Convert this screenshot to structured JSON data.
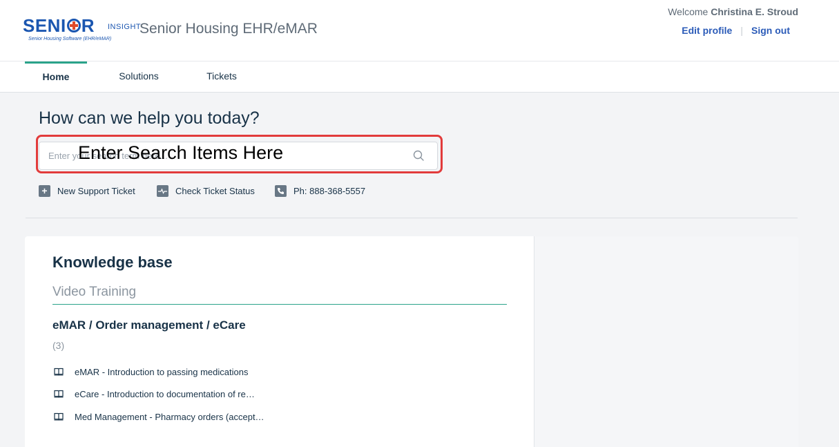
{
  "header": {
    "logo": {
      "main": "SENIOR",
      "suffix": "INSIGHT",
      "tagline": "Senior Housing Software (EHR/eMAR)"
    },
    "app_title": "Senior Housing EHR/eMAR",
    "welcome_prefix": "Welcome",
    "user_name": "Christina E. Stroud",
    "edit_profile": "Edit profile",
    "sign_out": "Sign out"
  },
  "nav": {
    "tabs": [
      {
        "label": "Home",
        "active": true
      },
      {
        "label": "Solutions",
        "active": false
      },
      {
        "label": "Tickets",
        "active": false
      }
    ]
  },
  "hero": {
    "title": "How can we help you today?",
    "search_placeholder": "Enter your search term here...",
    "annotation": "Enter Search Items Here",
    "quick_links": [
      {
        "label": "New Support Ticket",
        "icon": "plus-icon"
      },
      {
        "label": "Check Ticket Status",
        "icon": "pulse-icon"
      },
      {
        "label": "Ph: 888-368-5557",
        "icon": "phone-icon"
      }
    ]
  },
  "knowledge_base": {
    "title": "Knowledge base",
    "section": "Video Training",
    "category": "eMAR / Order management / eCare",
    "count": "(3)",
    "articles": [
      {
        "label": "eMAR - Introduction to passing medications"
      },
      {
        "label": "eCare - Introduction to documentation of re…"
      },
      {
        "label": "Med Management - Pharmacy orders (accept…"
      }
    ]
  },
  "colors": {
    "brand": "#1b56b0",
    "accent": "#2aa38a",
    "highlight": "#e23b3b",
    "link": "#2b5bb8"
  }
}
